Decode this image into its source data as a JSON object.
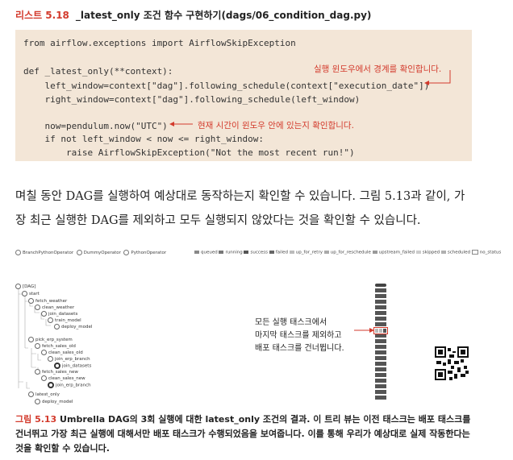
{
  "listing": {
    "number": "리스트 5.18",
    "title": "_latest_only 조건 함수 구현하기(dags/06_condition_dag.py)"
  },
  "code": {
    "lines": [
      "from airflow.exceptions import AirflowSkipException",
      "def _latest_only(**context):",
      "    left_window=context[\"dag\"].following_schedule(context[\"execution_date\"])",
      "    right_window=context[\"dag\"].following_schedule(left_window)",
      "    now=pendulum.now(\"UTC\")",
      "    if not left_window < now <= right_window:",
      "        raise AirflowSkipException(\"Not the most recent run!\")"
    ],
    "annotation_1": "실행 윈도우에서 경계를 확인합니다.",
    "annotation_2": "현재 시간이 윈도우 안에 있는지 확인합니다."
  },
  "body_text": {
    "line1": "며칠 동안 DAG를 실행하여 예상대로 동작하는지 확인할 수 있습니다. 그림 5.13과 같이, 가",
    "line2": "장 최근 실행한 DAG를 제외하고 모두 실행되지 않았다는 것을 확인할 수 있습니다."
  },
  "figure": {
    "operators": [
      "BranchPythonOperator",
      "DummyOperator",
      "PythonOperator"
    ],
    "legend": [
      "queued",
      "running",
      "success",
      "failed",
      "up_for_retry",
      "up_for_reschedule",
      "upstream_failed",
      "skipped",
      "scheduled",
      "no_status"
    ],
    "legend_colors": {
      "queued": "#888888",
      "running": "#777777",
      "success": "#555555",
      "failed": "#666666",
      "up_for_retry": "#bbbbbb",
      "up_for_reschedule": "#aaaaaa",
      "upstream_failed": "#999999",
      "skipped": "#cccccc",
      "scheduled": "#b0b0b0",
      "no_status": "#ffffff"
    },
    "tree": [
      "[DAG]",
      "start",
      "fetch_weather",
      "clean_weather",
      "join_datasets",
      "train_model",
      "deploy_model",
      "pick_erp_system",
      "fetch_sales_old",
      "clean_sales_old",
      "join_erp_branch",
      "join_datasets",
      "fetch_sales_new",
      "clean_sales_new",
      "join_erp_branch",
      "latest_only",
      "deploy_model"
    ],
    "callout": [
      "모든 실행 태스크에서",
      "마지막 태스크를 제외하고",
      "배포 태스크를 건너뜁니다."
    ]
  },
  "caption": {
    "number": "그림 5.13",
    "text": " Umbrella DAG의 3회 실행에 대한 latest_only 조건의 결과. 이 트리 뷰는 이전 태스크는 배포 태스크를 건너뛰고 가장 최근 실행에 대해서만 배포 태스크가 수행되었음을 보여줍니다. 이를 통해 우리가 예상대로 실제 작동한다는 것을 확인할 수 있습니다."
  }
}
